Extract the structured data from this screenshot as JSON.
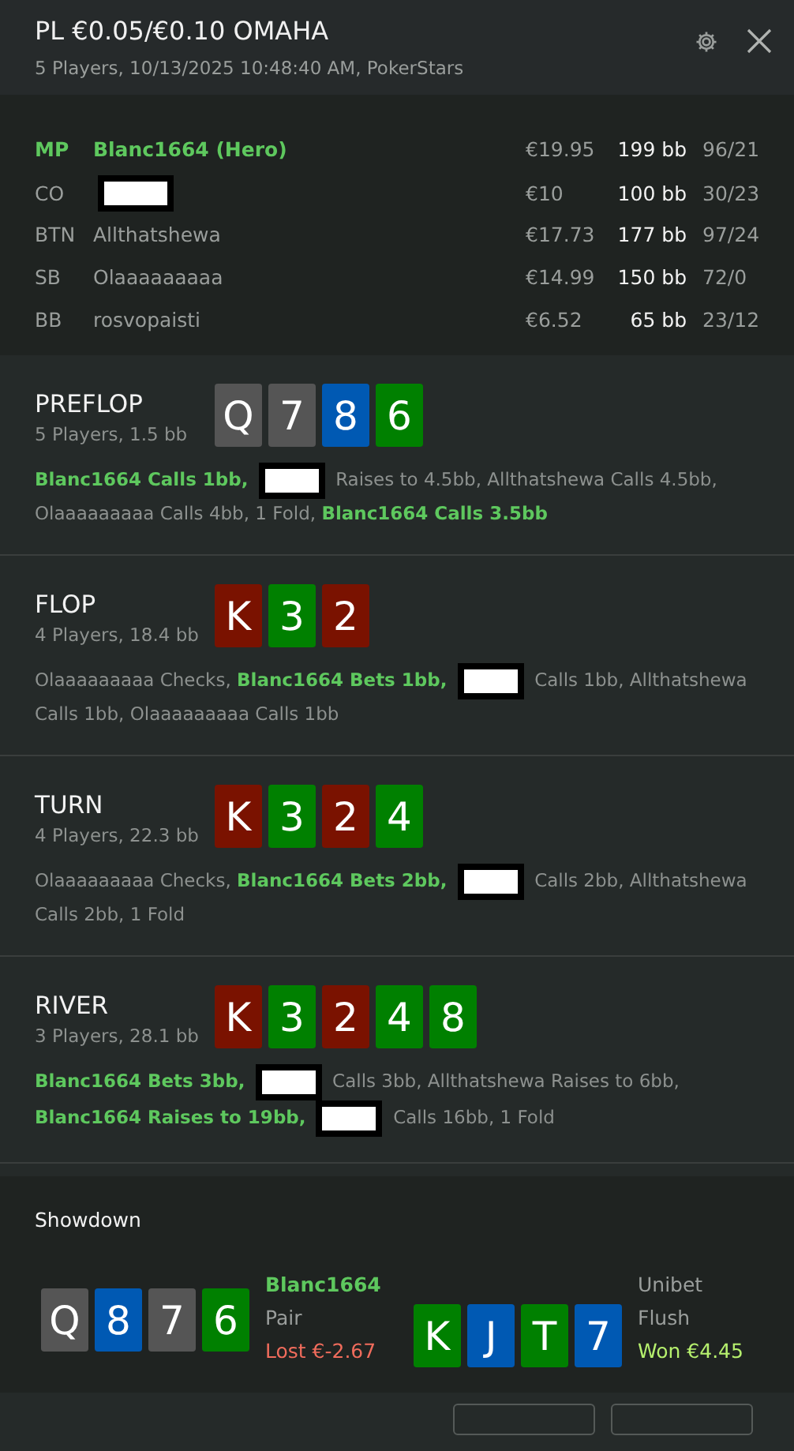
{
  "header": {
    "title": "PL €0.05/€0.10 OMAHA",
    "subtitle": "5 Players, 10/13/2025 10:48:40 AM, PokerStars"
  },
  "players": [
    {
      "position": "MP",
      "name": "Blanc1664 (Hero)",
      "hero": true,
      "redacted": false,
      "stack": "€19.95",
      "bb": "199 bb",
      "stats": "96/21"
    },
    {
      "position": "CO",
      "hero": false,
      "redacted": true,
      "stack": "€10",
      "bb": "100 bb",
      "stats": "30/23"
    },
    {
      "position": "BTN",
      "name": "Allthatshewa",
      "hero": false,
      "redacted": false,
      "stack": "€17.73",
      "bb": "177 bb",
      "stats": "97/24"
    },
    {
      "position": "SB",
      "name": "Olaaaaaaaaa",
      "hero": false,
      "redacted": false,
      "stack": "€14.99",
      "bb": "150 bb",
      "stats": "72/0"
    },
    {
      "position": "BB",
      "name": "rosvopaisti",
      "hero": false,
      "redacted": false,
      "stack": "€6.52",
      "bb": "65 bb",
      "stats": "23/12"
    }
  ],
  "streets": [
    {
      "name": "PREFLOP",
      "info": "5 Players, 1.5 bb",
      "cards": [
        {
          "rank": "Q",
          "color": "#555555"
        },
        {
          "rank": "7",
          "color": "#555555"
        },
        {
          "rank": "8",
          "color": "#0059b3"
        },
        {
          "rank": "6",
          "color": "#008000"
        }
      ],
      "actions": [
        {
          "kind": "hero",
          "text": "Blanc1664 Calls 1bb,"
        },
        {
          "kind": "redacted"
        },
        {
          "kind": "plain",
          "text": "Raises to 4.5bb, Allthatshewa Calls 4.5bb,"
        },
        {
          "kind": "plain",
          "text": "Olaaaaaaaaa Calls 4bb, 1 Fold,"
        },
        {
          "kind": "hero",
          "text": "Blanc1664 Calls 3.5bb"
        }
      ]
    },
    {
      "name": "FLOP",
      "info": "4 Players, 18.4 bb",
      "cards": [
        {
          "rank": "K",
          "color": "#7a1200"
        },
        {
          "rank": "3",
          "color": "#008000"
        },
        {
          "rank": "2",
          "color": "#7a1200"
        }
      ],
      "actions": [
        {
          "kind": "plain",
          "text": "Olaaaaaaaaa Checks,"
        },
        {
          "kind": "hero",
          "text": "Blanc1664 Bets 1bb,"
        },
        {
          "kind": "redacted"
        },
        {
          "kind": "plain",
          "text": "Calls 1bb, Allthatshewa"
        },
        {
          "kind": "plain",
          "text": "Calls 1bb, Olaaaaaaaaa Calls 1bb"
        }
      ]
    },
    {
      "name": "TURN",
      "info": "4 Players, 22.3 bb",
      "cards": [
        {
          "rank": "K",
          "color": "#7a1200"
        },
        {
          "rank": "3",
          "color": "#008000"
        },
        {
          "rank": "2",
          "color": "#7a1200"
        },
        {
          "rank": "4",
          "color": "#008000"
        }
      ],
      "actions": [
        {
          "kind": "plain",
          "text": "Olaaaaaaaaa Checks,"
        },
        {
          "kind": "hero",
          "text": "Blanc1664 Bets 2bb,"
        },
        {
          "kind": "redacted"
        },
        {
          "kind": "plain",
          "text": "Calls 2bb, Allthatshewa"
        },
        {
          "kind": "plain",
          "text": "Calls 2bb, 1 Fold"
        }
      ]
    },
    {
      "name": "RIVER",
      "info": "3 Players, 28.1 bb",
      "cards": [
        {
          "rank": "K",
          "color": "#7a1200"
        },
        {
          "rank": "3",
          "color": "#008000"
        },
        {
          "rank": "2",
          "color": "#7a1200"
        },
        {
          "rank": "4",
          "color": "#008000"
        },
        {
          "rank": "8",
          "color": "#008000"
        }
      ],
      "actions": [
        {
          "kind": "hero",
          "text": "Blanc1664 Bets 3bb,"
        },
        {
          "kind": "redacted"
        },
        {
          "kind": "plain",
          "text": "Calls 3bb, Allthatshewa Raises to 6bb,"
        },
        {
          "kind": "hero",
          "text": "Blanc1664 Raises to 19bb,"
        },
        {
          "kind": "redacted"
        },
        {
          "kind": "plain",
          "text": "Calls 16bb, 1 Fold"
        }
      ]
    }
  ],
  "showdown": {
    "title": "Showdown",
    "hands": [
      {
        "player": "Blanc1664",
        "hero": true,
        "hand": "Pair",
        "result": "Lost €-2.67",
        "won": false,
        "cards": [
          {
            "rank": "Q",
            "color": "#555555"
          },
          {
            "rank": "8",
            "color": "#0059b3"
          },
          {
            "rank": "7",
            "color": "#555555"
          },
          {
            "rank": "6",
            "color": "#008000"
          }
        ]
      },
      {
        "player": "Unibet",
        "hero": false,
        "hand": "Flush",
        "result": "Won €4.45",
        "won": true,
        "cards": [
          {
            "rank": "K",
            "color": "#008000"
          },
          {
            "rank": "J",
            "color": "#0059b3"
          },
          {
            "rank": "T",
            "color": "#008000"
          },
          {
            "rank": "7",
            "color": "#0059b3"
          }
        ]
      }
    ]
  }
}
